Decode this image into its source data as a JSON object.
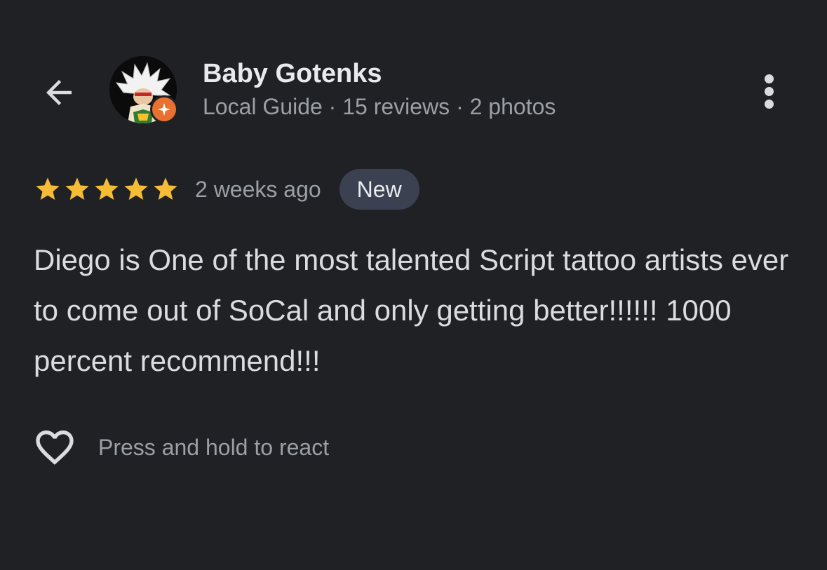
{
  "author": {
    "name": "Baby Gotenks",
    "meta": "Local Guide · 15 reviews · 2 photos"
  },
  "review": {
    "rating": 5,
    "rating_max": 5,
    "date": "2 weeks ago",
    "badge": "New",
    "text": "Diego is One of the most talented Script tattoo artists ever to come out of SoCal and only getting better!!!!!! 1000 percent recommend!!!"
  },
  "react": {
    "label": "Press and hold to react"
  },
  "icons": {
    "back": "arrow-left-icon",
    "more": "more-vert-icon",
    "star": "star-icon",
    "heart": "heart-outline-icon",
    "guide": "local-guide-badge-icon"
  },
  "colors": {
    "background": "#202124",
    "star": "#f6bc35",
    "badge_bg": "#3c4152",
    "guide_badge": "#e8712f",
    "secondary_text": "#9aa0a6"
  }
}
